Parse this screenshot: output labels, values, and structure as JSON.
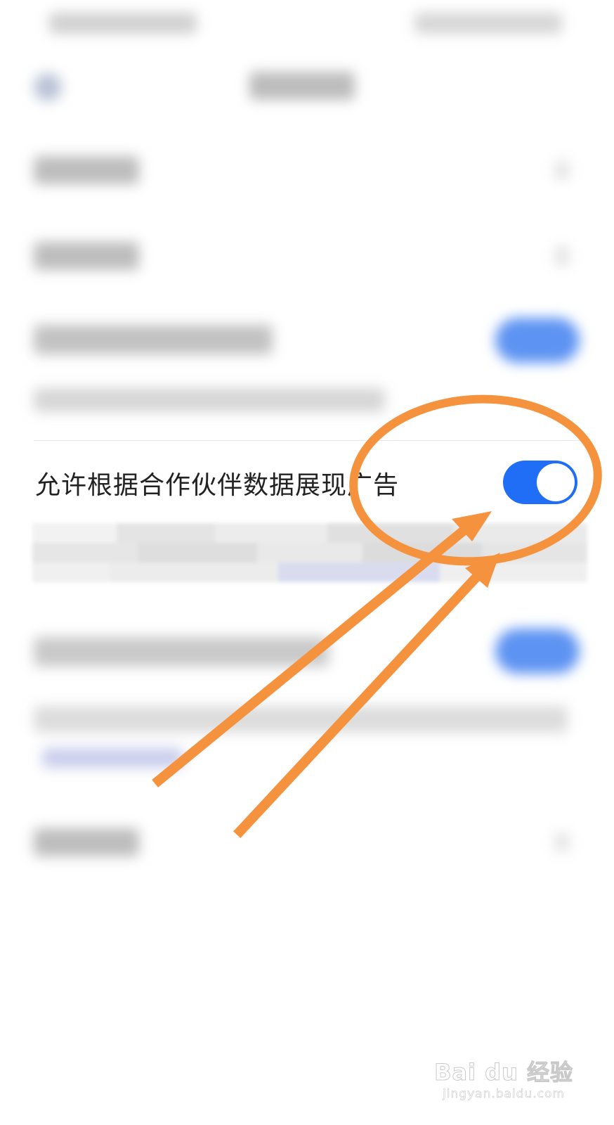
{
  "setting_row": {
    "label": "允许根据合作伙伴数据展现广告",
    "toggle_state": "on"
  },
  "colors": {
    "toggle_on": "#1f6ef5",
    "annotation": "#f5923e",
    "text": "#222222"
  },
  "watermark": {
    "brand": "Bai du 经验",
    "url": "jingyan.baidu.com"
  }
}
